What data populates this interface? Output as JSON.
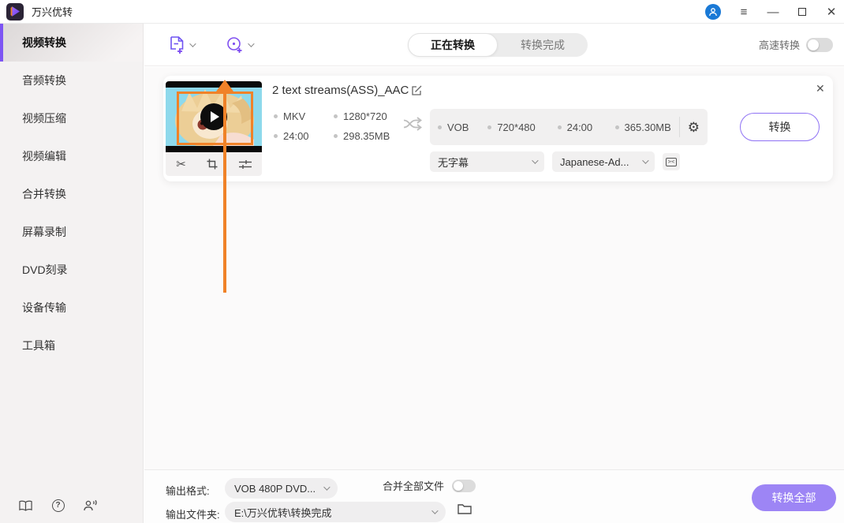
{
  "titlebar": {
    "app_title": "万兴优转"
  },
  "icons": {
    "hamburger": "≡",
    "minimize": "—",
    "close": "✕",
    "row_close": "✕",
    "scissors": "✂",
    "gear": "⚙",
    "subtitle_box": "><",
    "help": "?"
  },
  "sidebar": {
    "items": [
      {
        "label": "视频转换",
        "active": true
      },
      {
        "label": "音频转换",
        "active": false
      },
      {
        "label": "视频压缩",
        "active": false
      },
      {
        "label": "视频编辑",
        "active": false
      },
      {
        "label": "合并转换",
        "active": false
      },
      {
        "label": "屏幕录制",
        "active": false
      },
      {
        "label": "DVD刻录",
        "active": false
      },
      {
        "label": "设备传输",
        "active": false
      },
      {
        "label": "工具箱",
        "active": false
      }
    ]
  },
  "toolbar": {
    "tabs": [
      {
        "label": "正在转换",
        "active": true
      },
      {
        "label": "转换完成",
        "active": false
      }
    ],
    "fast_convert_label": "高速转换",
    "fast_convert_on": false
  },
  "file": {
    "title": "2 text streams(ASS)_AAC",
    "source": [
      "MKV",
      "1280*720",
      "24:00",
      "298.35MB"
    ],
    "target": [
      "VOB",
      "720*480",
      "24:00",
      "365.30MB"
    ],
    "subtitle_select": "无字幕",
    "audio_select": "Japanese-Ad...",
    "convert_button": "转换"
  },
  "footer": {
    "output_format_label": "输出格式:",
    "output_format_value": "VOB 480P DVD...",
    "merge_all_label": "合并全部文件",
    "merge_all_on": false,
    "output_folder_label": "输出文件夹:",
    "output_folder_value": "E:\\万兴优转\\转换完成",
    "convert_all_button": "转换全部"
  },
  "colors": {
    "accent_purple": "#7d55f3",
    "button_purple": "#9d85f5",
    "highlight_orange": "#f08228",
    "avatar_blue": "#1a79d6"
  }
}
